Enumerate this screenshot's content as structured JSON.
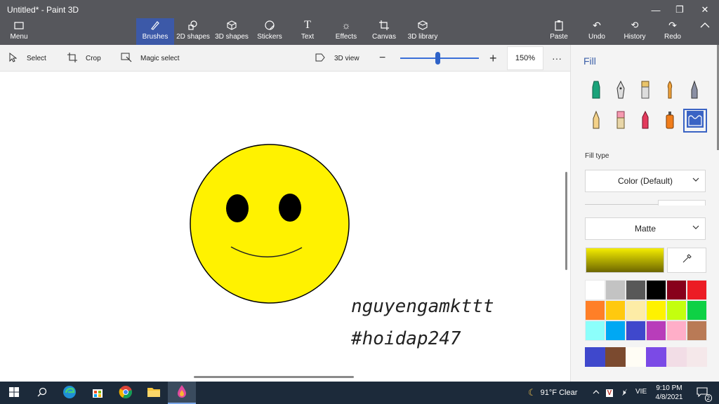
{
  "window": {
    "title": "Untitled* - Paint 3D"
  },
  "ribbon": {
    "menu": "Menu",
    "tools": [
      {
        "label": "Brushes",
        "icon": "brush-icon",
        "active": true
      },
      {
        "label": "2D shapes",
        "icon": "2d-shapes-icon"
      },
      {
        "label": "3D shapes",
        "icon": "3d-shapes-icon"
      },
      {
        "label": "Stickers",
        "icon": "stickers-icon"
      },
      {
        "label": "Text",
        "icon": "text-icon"
      },
      {
        "label": "Effects",
        "icon": "effects-icon"
      },
      {
        "label": "Canvas",
        "icon": "canvas-icon"
      },
      {
        "label": "3D library",
        "icon": "3d-library-icon"
      }
    ],
    "paste": "Paste",
    "undo": "Undo",
    "history": "History",
    "redo": "Redo"
  },
  "toolbar": {
    "select": "Select",
    "crop": "Crop",
    "magic_select": "Magic select",
    "view_3d": "3D view",
    "zoom": "150%",
    "zoom_level": 0.47
  },
  "canvas": {
    "text_line1": "nguyengamkttt",
    "text_line2": "#hoidap247"
  },
  "panel": {
    "title": "Fill",
    "fill_type_label": "Fill type",
    "fill_type_value": "Color (Default)",
    "finish_value": "Matte",
    "current_color": "#f4ed00",
    "palette": [
      "#ffffff",
      "#c3c3c3",
      "#585858",
      "#000000",
      "#88001b",
      "#ec1c24",
      "#ff7f27",
      "#ffc90e",
      "#fdeca6",
      "#fff200",
      "#c4ff0e",
      "#0ed145",
      "#8cfffb",
      "#00a8f3",
      "#3f48cc",
      "#b83dba",
      "#ffaec8",
      "#b97a56"
    ],
    "custom": [
      "#3f48cc",
      "#7b4a2f",
      "#fffdf5",
      "#7b4ae6",
      "#f2dde6",
      "#f5e8ea"
    ]
  },
  "taskbar": {
    "weather": "91°F  Clear",
    "lang": "VIE",
    "time": "9:10 PM",
    "date": "4/8/2021",
    "notifications": "2"
  }
}
